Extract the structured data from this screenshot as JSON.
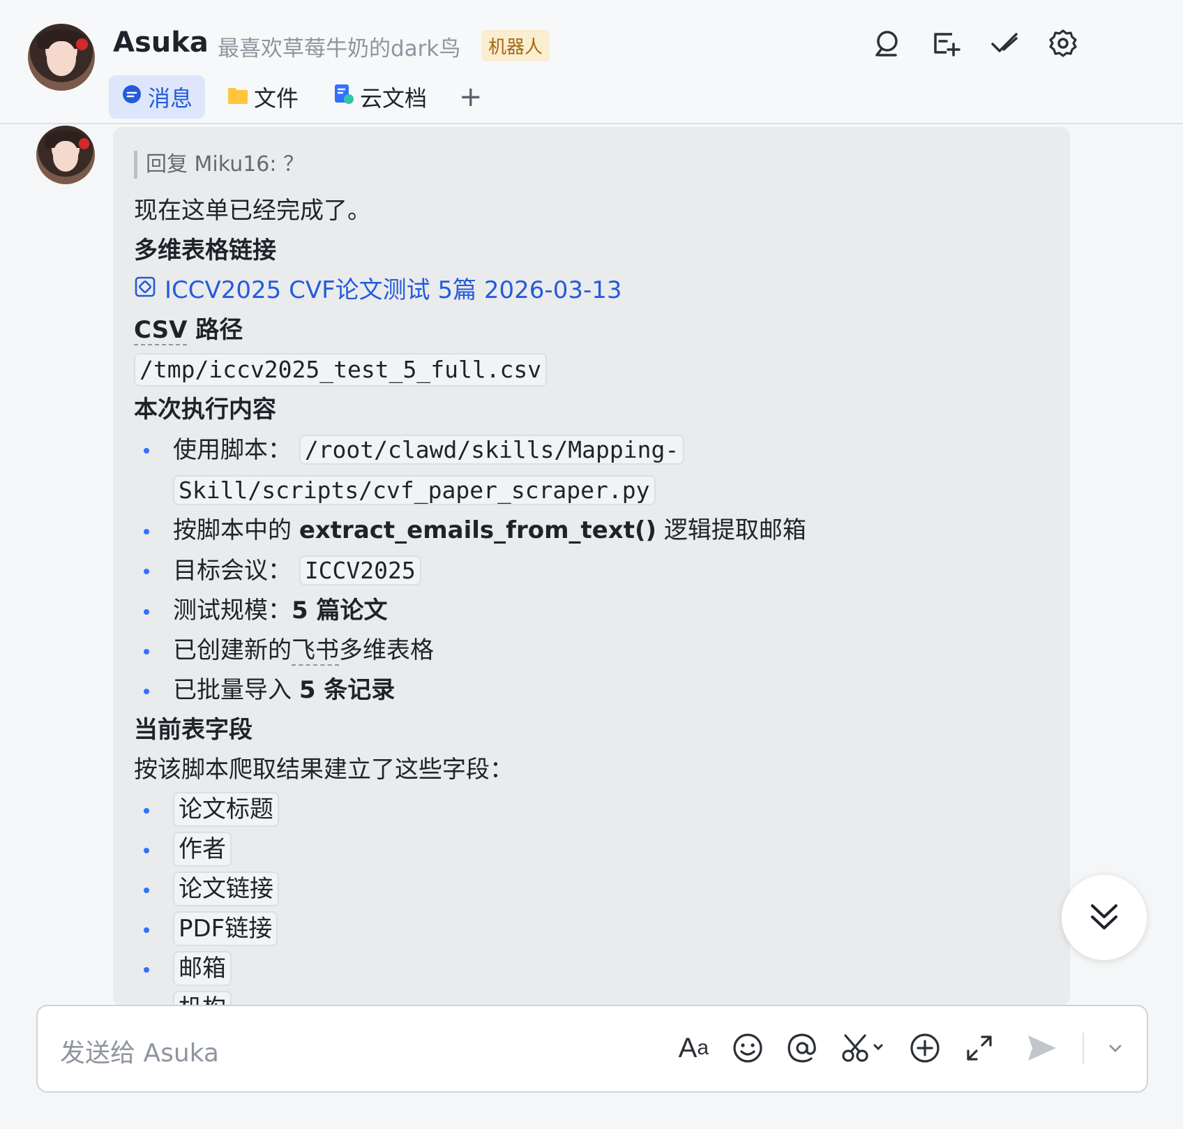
{
  "header": {
    "name": "Asuka",
    "signature": "最喜欢草莓牛奶的dark鸟",
    "badge": "机器人",
    "tabs": [
      {
        "label": "消息",
        "icon": "chat-bubble-icon",
        "active": true
      },
      {
        "label": "文件",
        "icon": "folder-icon",
        "active": false
      },
      {
        "label": "云文档",
        "icon": "cloud-doc-icon",
        "active": false
      }
    ],
    "add_tab": "+"
  },
  "message": {
    "reply_quote": "回复 Miku16: ？",
    "line1": "现在这单已经完成了。",
    "h_table": "多维表格链接",
    "table_link": "ICCV2025 CVF论文测试 5篇 2026-03-13",
    "h_csv_a": "CSV",
    "h_csv_b": " 路径",
    "csv_path": "/tmp/iccv2025_test_5_full.csv",
    "h_exec": "本次执行内容",
    "exec": {
      "script_label": "使用脚本：",
      "script_path_1": "/root/clawd/skills/Mapping-",
      "script_path_2": "Skill/scripts/cvf_paper_scraper.py",
      "extract_pre": "按脚本中的 ",
      "extract_fn": "extract_emails_from_text()",
      "extract_post": " 逻辑提取邮箱",
      "conf_label": "目标会议：",
      "conf_value": "ICCV2025",
      "scale_label": "测试规模：",
      "scale_value": "5 篇论文",
      "created_pre": "已创建新的",
      "created_link": "飞书",
      "created_post": "多维表格",
      "import_pre": "已批量导入 ",
      "import_value": "5 条记录"
    },
    "h_fields": "当前表字段",
    "fields_intro": "按该脚本爬取结果建立了这些字段：",
    "fields": [
      "论文标题",
      "作者",
      "论文链接",
      "PDF链接",
      "邮箱",
      "机构"
    ]
  },
  "input": {
    "placeholder": "发送给 Asuka"
  },
  "colors": {
    "accent": "#245bdb",
    "bullet": "#3370ff",
    "bubble": "#eaebed",
    "badge_bg": "#fbedcf",
    "badge_fg": "#a36b13"
  }
}
